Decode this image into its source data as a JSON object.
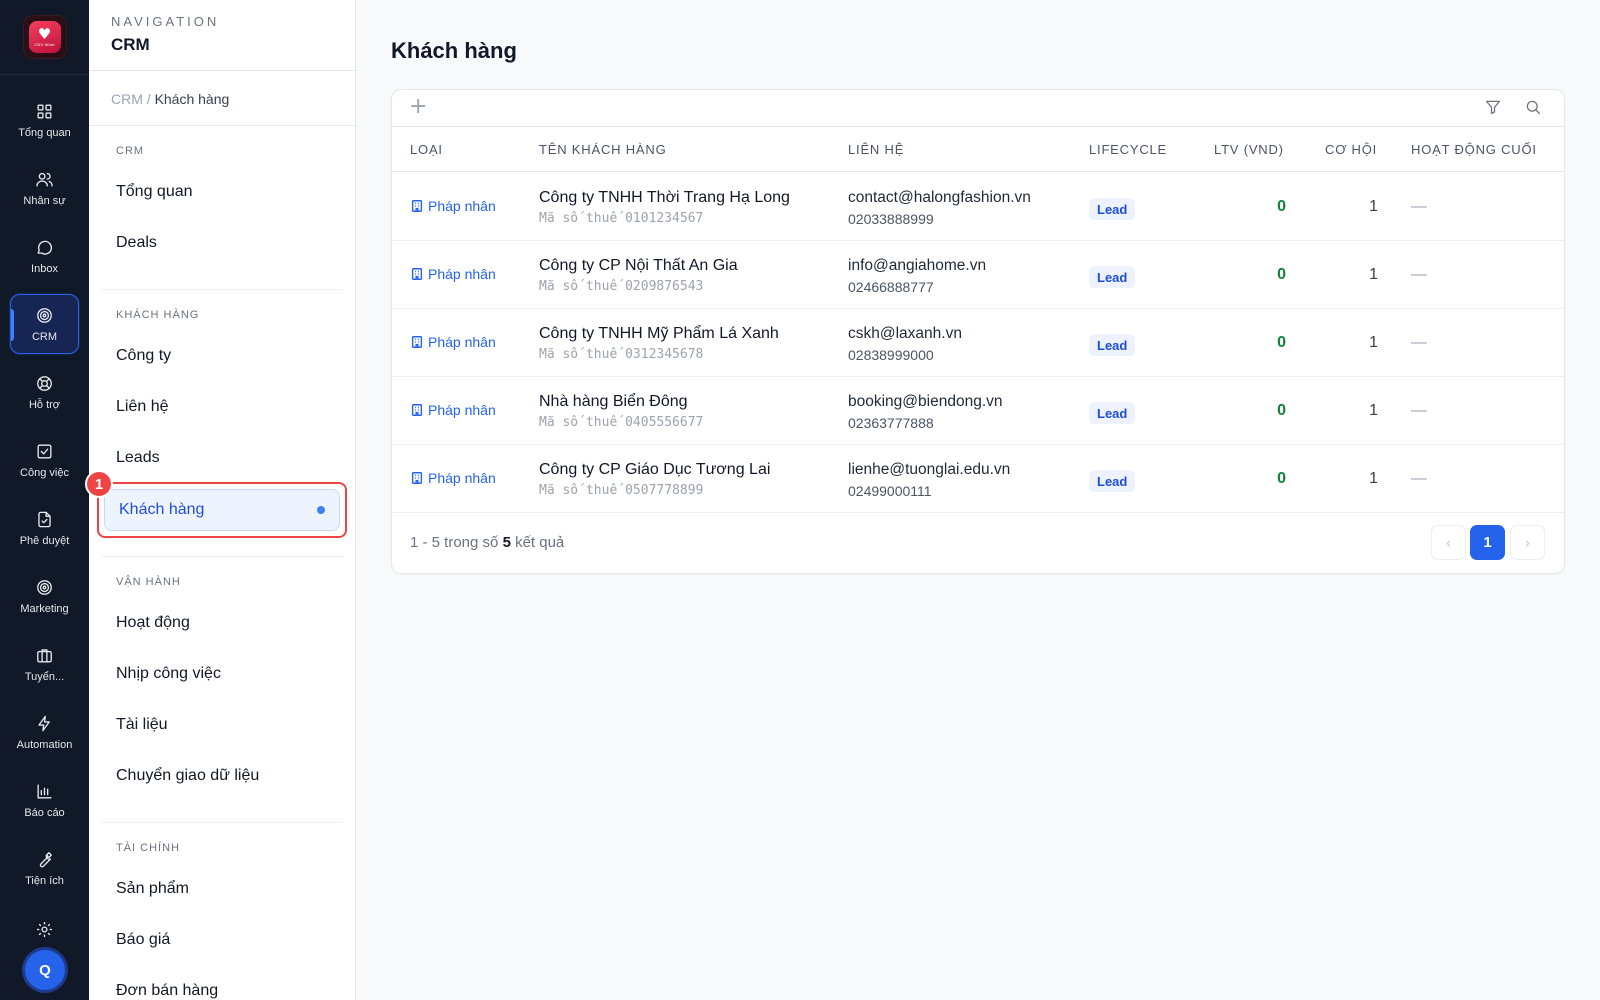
{
  "app": {
    "logo_text": "CNV Work",
    "avatar_initial": "Q"
  },
  "rail": {
    "items": [
      {
        "label": "Tổng quan",
        "icon": "grid-icon"
      },
      {
        "label": "Nhân sự",
        "icon": "users-icon"
      },
      {
        "label": "Inbox",
        "icon": "chat-icon"
      },
      {
        "label": "CRM",
        "icon": "target-icon"
      },
      {
        "label": "Hỗ trợ",
        "icon": "lifebuoy-icon"
      },
      {
        "label": "Công việc",
        "icon": "checkbox-icon"
      },
      {
        "label": "Phê duyệt",
        "icon": "file-check-icon"
      },
      {
        "label": "Marketing",
        "icon": "target-icon"
      },
      {
        "label": "Tuyển...",
        "icon": "briefcase-icon"
      },
      {
        "label": "Automation",
        "icon": "bolt-icon"
      },
      {
        "label": "Báo cáo",
        "icon": "bar-chart-icon"
      },
      {
        "label": "Tiện ích",
        "icon": "wrench-icon"
      }
    ],
    "active": "CRM"
  },
  "sidebar": {
    "caption": "NAVIGATION",
    "title": "CRM",
    "breadcrumb": {
      "root": "CRM",
      "sep": " / ",
      "current": "Khách hàng"
    },
    "sections": [
      {
        "label": "CRM",
        "items": [
          "Tổng quan",
          "Deals"
        ]
      },
      {
        "label": "KHÁCH HÀNG",
        "items": [
          "Công ty",
          "Liên hệ",
          "Leads",
          "Khách hàng"
        ]
      },
      {
        "label": "VẬN HÀNH",
        "items": [
          "Hoạt động",
          "Nhịp công việc",
          "Tài liệu",
          "Chuyển giao dữ liệu"
        ]
      },
      {
        "label": "TÀI CHÍNH",
        "items": [
          "Sản phẩm",
          "Báo giá",
          "Đơn bán hàng"
        ]
      }
    ],
    "active_item": "Khách hàng",
    "annotation_badge": "1"
  },
  "main": {
    "title": "Khách hàng",
    "toolbar": {
      "add_symbol": "+",
      "icons": [
        "filter-icon",
        "search-icon"
      ]
    },
    "columns": [
      "LOẠI",
      "TÊN KHÁCH HÀNG",
      "LIÊN HỆ",
      "LIFECYCLE",
      "LTV (VND)",
      "CƠ HỘI",
      "HOẠT ĐỘNG CUỐI"
    ],
    "rows": [
      {
        "type": "Pháp nhân",
        "name": "Công ty TNHH Thời Trang Hạ Long",
        "tax": "Mã số thuế 0101234567",
        "email": "contact@halongfashion.vn",
        "phone": "02033888999",
        "lifecycle": "Lead",
        "ltv": "0",
        "opportunities": "1",
        "last_activity": "—"
      },
      {
        "type": "Pháp nhân",
        "name": "Công ty CP Nội Thất An Gia",
        "tax": "Mã số thuế 0209876543",
        "email": "info@angiahome.vn",
        "phone": "02466888777",
        "lifecycle": "Lead",
        "ltv": "0",
        "opportunities": "1",
        "last_activity": "—"
      },
      {
        "type": "Pháp nhân",
        "name": "Công ty TNHH Mỹ Phẩm Lá Xanh",
        "tax": "Mã số thuế 0312345678",
        "email": "cskh@laxanh.vn",
        "phone": "02838999000",
        "lifecycle": "Lead",
        "ltv": "0",
        "opportunities": "1",
        "last_activity": "—"
      },
      {
        "type": "Pháp nhân",
        "name": "Nhà hàng Biển Đông",
        "tax": "Mã số thuế 0405556677",
        "email": "booking@biendong.vn",
        "phone": "02363777888",
        "lifecycle": "Lead",
        "ltv": "0",
        "opportunities": "1",
        "last_activity": "—"
      },
      {
        "type": "Pháp nhân",
        "name": "Công ty CP Giáo Dục Tương Lai",
        "tax": "Mã số thuế 0507778899",
        "email": "lienhe@tuonglai.edu.vn",
        "phone": "02499000111",
        "lifecycle": "Lead",
        "ltv": "0",
        "opportunities": "1",
        "last_activity": "—"
      }
    ],
    "pagination": {
      "summary_prefix": "1 - 5 trong số ",
      "total": "5",
      "summary_suffix": " kết quả",
      "current_page": "1",
      "prev_symbol": "‹",
      "next_symbol": "›"
    },
    "colors": {
      "accent": "#2563eb",
      "ltv": "#15803d",
      "highlight": "#ef4444"
    }
  }
}
